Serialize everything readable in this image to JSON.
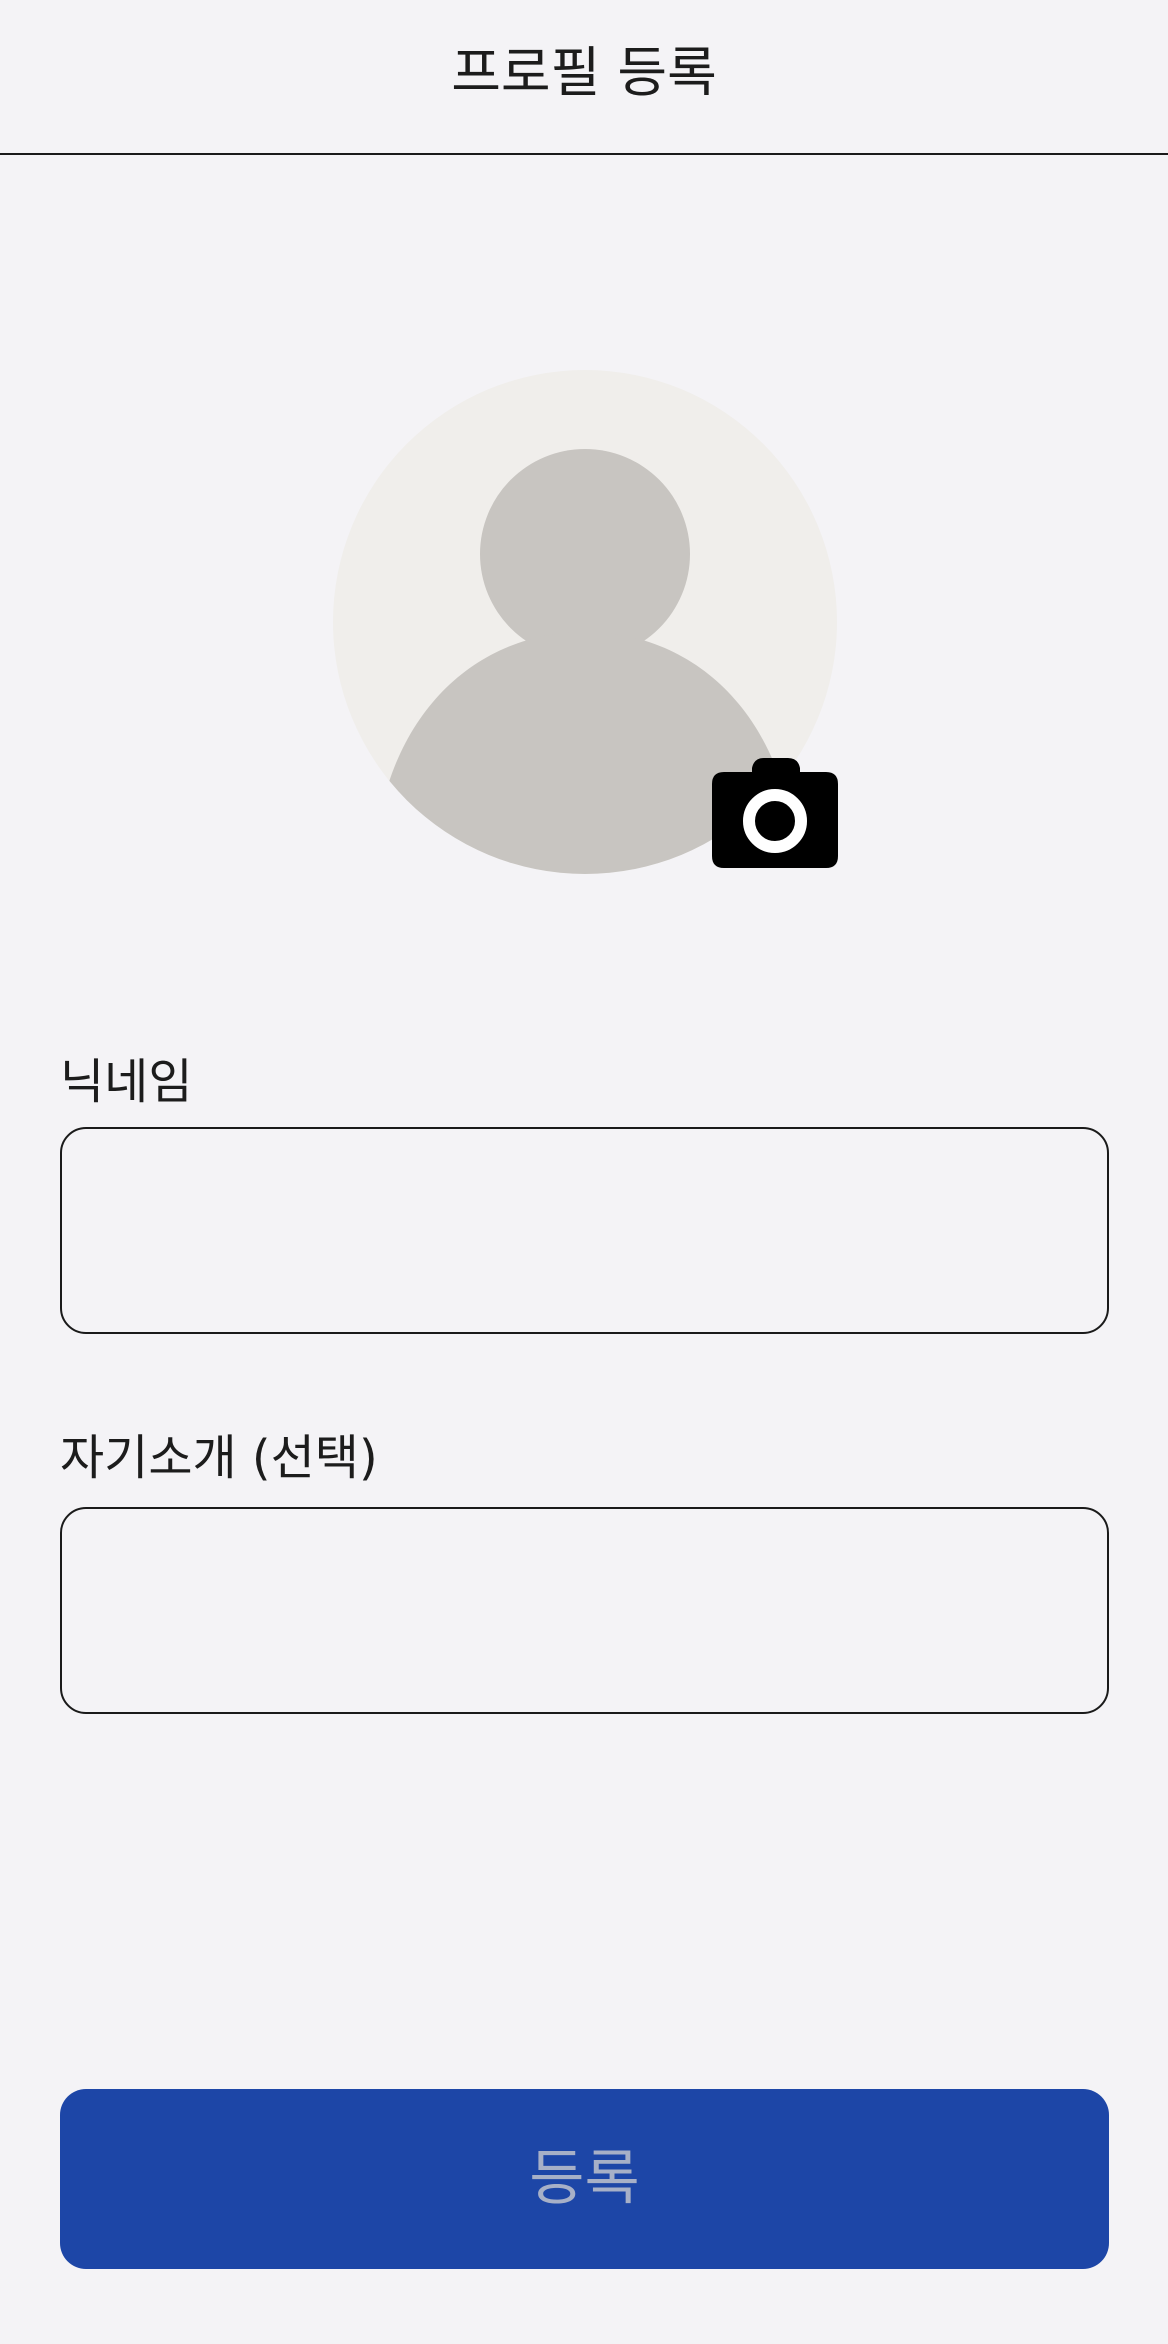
{
  "header": {
    "title": "프로필 등록"
  },
  "avatar": {
    "icon": "default-avatar-icon",
    "camera_icon": "camera-icon",
    "background_color": "#f0eeeb",
    "figure_color": "#c8c5c1"
  },
  "form": {
    "nickname": {
      "label": "닉네임",
      "value": "",
      "placeholder": ""
    },
    "bio": {
      "label": "자기소개 (선택)",
      "value": "",
      "placeholder": ""
    }
  },
  "submit": {
    "label": "등록",
    "background_color": "#1d46a7",
    "text_color": "#a7b0c7",
    "state": "disabled"
  },
  "colors": {
    "page_background": "#f4f3f6",
    "text": "#1c1c1c",
    "border": "#1a1a1a"
  }
}
